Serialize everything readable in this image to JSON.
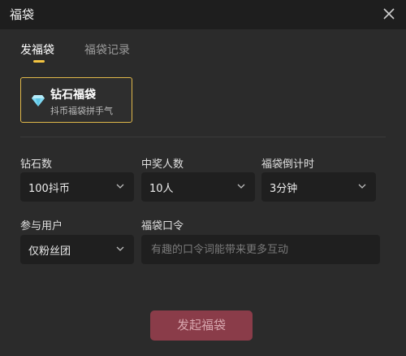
{
  "window": {
    "title": "福袋"
  },
  "tabs": [
    {
      "label": "发福袋",
      "active": true
    },
    {
      "label": "福袋记录",
      "active": false
    }
  ],
  "gift_card": {
    "title": "钻石福袋",
    "subtitle": "抖币福袋拼手气",
    "icon": "diamond-icon"
  },
  "form": {
    "diamond_count": {
      "label": "钻石数",
      "value": "100抖币"
    },
    "winner_count": {
      "label": "中奖人数",
      "value": "10人"
    },
    "countdown": {
      "label": "福袋倒计时",
      "value": "3分钟"
    },
    "participants": {
      "label": "参与用户",
      "value": "仅粉丝团"
    },
    "password": {
      "label": "福袋口令",
      "placeholder": "有趣的口令词能带来更多互动",
      "value": ""
    }
  },
  "submit": {
    "label": "发起福袋"
  },
  "colors": {
    "accent": "#f4c542",
    "card_border": "#e0b84a",
    "submit_bg": "#8a3c49",
    "diamond": "#7fd8f2"
  }
}
